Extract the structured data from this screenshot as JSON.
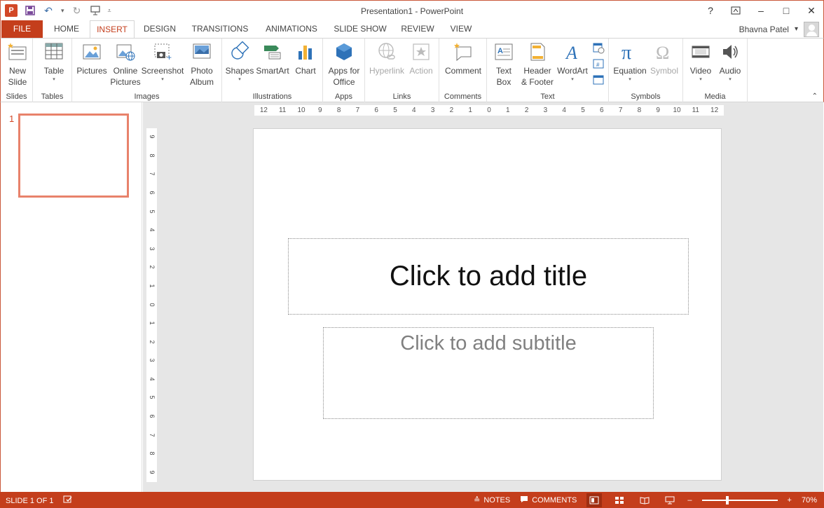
{
  "window": {
    "title": "Presentation1 - PowerPoint",
    "app_icon_letter": "P",
    "help": "?",
    "ribbon_display": "↑",
    "minimize": "–",
    "maximize": "□",
    "close": "✕"
  },
  "tabs": [
    "FILE",
    "HOME",
    "INSERT",
    "DESIGN",
    "TRANSITIONS",
    "ANIMATIONS",
    "SLIDE SHOW",
    "REVIEW",
    "VIEW"
  ],
  "active_tab": "INSERT",
  "user": {
    "name": "Bhavna Patel",
    "caret": "▾"
  },
  "ribbon": {
    "groups": {
      "slides": "Slides",
      "tables": "Tables",
      "images": "Images",
      "illustrations": "Illustrations",
      "apps": "Apps",
      "links": "Links",
      "comments": "Comments",
      "text": "Text",
      "symbols": "Symbols",
      "media": "Media"
    },
    "buttons": {
      "new_slide_1": "New",
      "new_slide_2": "Slide",
      "table": "Table",
      "pictures": "Pictures",
      "online_pictures_1": "Online",
      "online_pictures_2": "Pictures",
      "screenshot": "Screenshot",
      "photo_album_1": "Photo",
      "photo_album_2": "Album",
      "shapes": "Shapes",
      "smartart": "SmartArt",
      "chart": "Chart",
      "apps_for_office_1": "Apps for",
      "apps_for_office_2": "Office",
      "hyperlink": "Hyperlink",
      "action": "Action",
      "comment": "Comment",
      "text_box_1": "Text",
      "text_box_2": "Box",
      "header_footer_1": "Header",
      "header_footer_2": "& Footer",
      "wordart": "WordArt",
      "equation": "Equation",
      "symbol": "Symbol",
      "video": "Video",
      "audio": "Audio"
    },
    "colors": {
      "accent": "#c43e1c",
      "blue": "#2e72b8",
      "green": "#3a8a5a",
      "disabled": "#a8a8a8"
    }
  },
  "thumbnails": {
    "slide_number": "1"
  },
  "rulers": {
    "horizontal": [
      "12",
      "11",
      "10",
      "9",
      "8",
      "7",
      "6",
      "5",
      "4",
      "3",
      "2",
      "1",
      "0",
      "1",
      "2",
      "3",
      "4",
      "5",
      "6",
      "7",
      "8",
      "9",
      "10",
      "11",
      "12"
    ],
    "vertical": [
      "9",
      "8",
      "7",
      "6",
      "5",
      "4",
      "3",
      "2",
      "1",
      "0",
      "1",
      "2",
      "3",
      "4",
      "5",
      "6",
      "7",
      "8",
      "9"
    ]
  },
  "slide": {
    "title_placeholder": "Click to add title",
    "subtitle_placeholder": "Click to add subtitle"
  },
  "statusbar": {
    "slide_info": "SLIDE 1 OF 1",
    "notes": "NOTES",
    "comments": "COMMENTS",
    "zoom_minus": "–",
    "zoom_plus": "+",
    "zoom": "70%",
    "zoom_level_fraction": 0.32
  }
}
